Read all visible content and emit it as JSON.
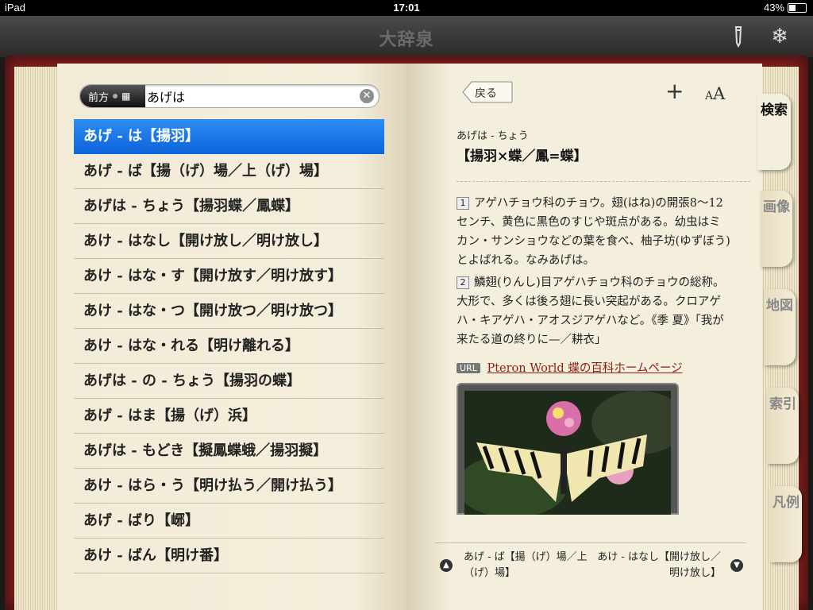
{
  "status_bar": {
    "device": "iPad",
    "time": "17:01",
    "battery": "43%",
    "battery_level": 0.43
  },
  "app": {
    "title": "大辞泉"
  },
  "search": {
    "mode_label": "前方",
    "query": "あげは"
  },
  "results": [
    {
      "text": "あげ - は【揚羽】",
      "selected": true
    },
    {
      "text": "あげ - ば【揚（げ）場／上（げ）場】",
      "selected": false
    },
    {
      "text": "あげは - ちょう【揚羽蝶／鳳蝶】",
      "selected": false
    },
    {
      "text": "あけ - はなし【開け放し／明け放し】",
      "selected": false
    },
    {
      "text": "あけ - はな・す【開け放す／明け放す】",
      "selected": false
    },
    {
      "text": "あけ - はな・つ【開け放つ／明け放つ】",
      "selected": false
    },
    {
      "text": "あけ - はな・れる【明け離れる】",
      "selected": false
    },
    {
      "text": "あげは - の - ちょう【揚羽の蝶】",
      "selected": false
    },
    {
      "text": "あげ - はま【揚（げ）浜】",
      "selected": false
    },
    {
      "text": "あげは - もどき【擬鳳蝶蛾／揚羽擬】",
      "selected": false
    },
    {
      "text": "あけ - はら・う【明け払う／開け払う】",
      "selected": false
    },
    {
      "text": "あげ - ばり【峫】",
      "selected": false
    },
    {
      "text": "あけ - ばん【明け番】",
      "selected": false
    }
  ],
  "toolbar": {
    "back_label": "戻る",
    "add_label": "+",
    "font_small": "A",
    "font_large": "A"
  },
  "entry": {
    "reading": "あげは - ちょう",
    "headword": "【揚羽×蝶／鳳=蝶】",
    "def1_num": "1",
    "def1": "アゲハチョウ科のチョウ。翅(はね)の開張8〜12センチ、黄色に黒色のすじや斑点がある。幼虫はミカン・サンショウなどの葉を食べ、柚子坊(ゆずぼう)とよばれる。なみあげは。",
    "def2_num": "2",
    "def2": "鱗翅(りんし)目アゲハチョウ科のチョウの総称。大形で、多くは後ろ翅に長い突起がある。クロアゲハ・キアゲハ・アオスジアゲハなど。《季 夏》「我が来たる道の終りに—／耕衣」",
    "url_badge": "URL",
    "url_text": "Pteron World 蝶の百科ホームページ"
  },
  "bottom_nav": {
    "prev": "あげ - ば【揚（げ）場／上（げ）場】",
    "next": "あけ - はなし【開け放し／明け放し】"
  },
  "tabs": [
    {
      "label": "検索",
      "active": true
    },
    {
      "label": "画像",
      "active": false
    },
    {
      "label": "地図",
      "active": false
    },
    {
      "label": "索引",
      "active": false
    },
    {
      "label": "凡例",
      "active": false
    }
  ],
  "colors": {
    "selection": "#1a73e8",
    "link": "#8b1d16",
    "book_cover": "#7a1f1c"
  },
  "icons": [
    "pencil-icon",
    "gear-icon",
    "clear-icon",
    "grid-icon",
    "back-arrow-icon",
    "plus-icon",
    "font-size-icon",
    "arrow-up-icon",
    "arrow-down-icon",
    "butterfly-photo"
  ]
}
